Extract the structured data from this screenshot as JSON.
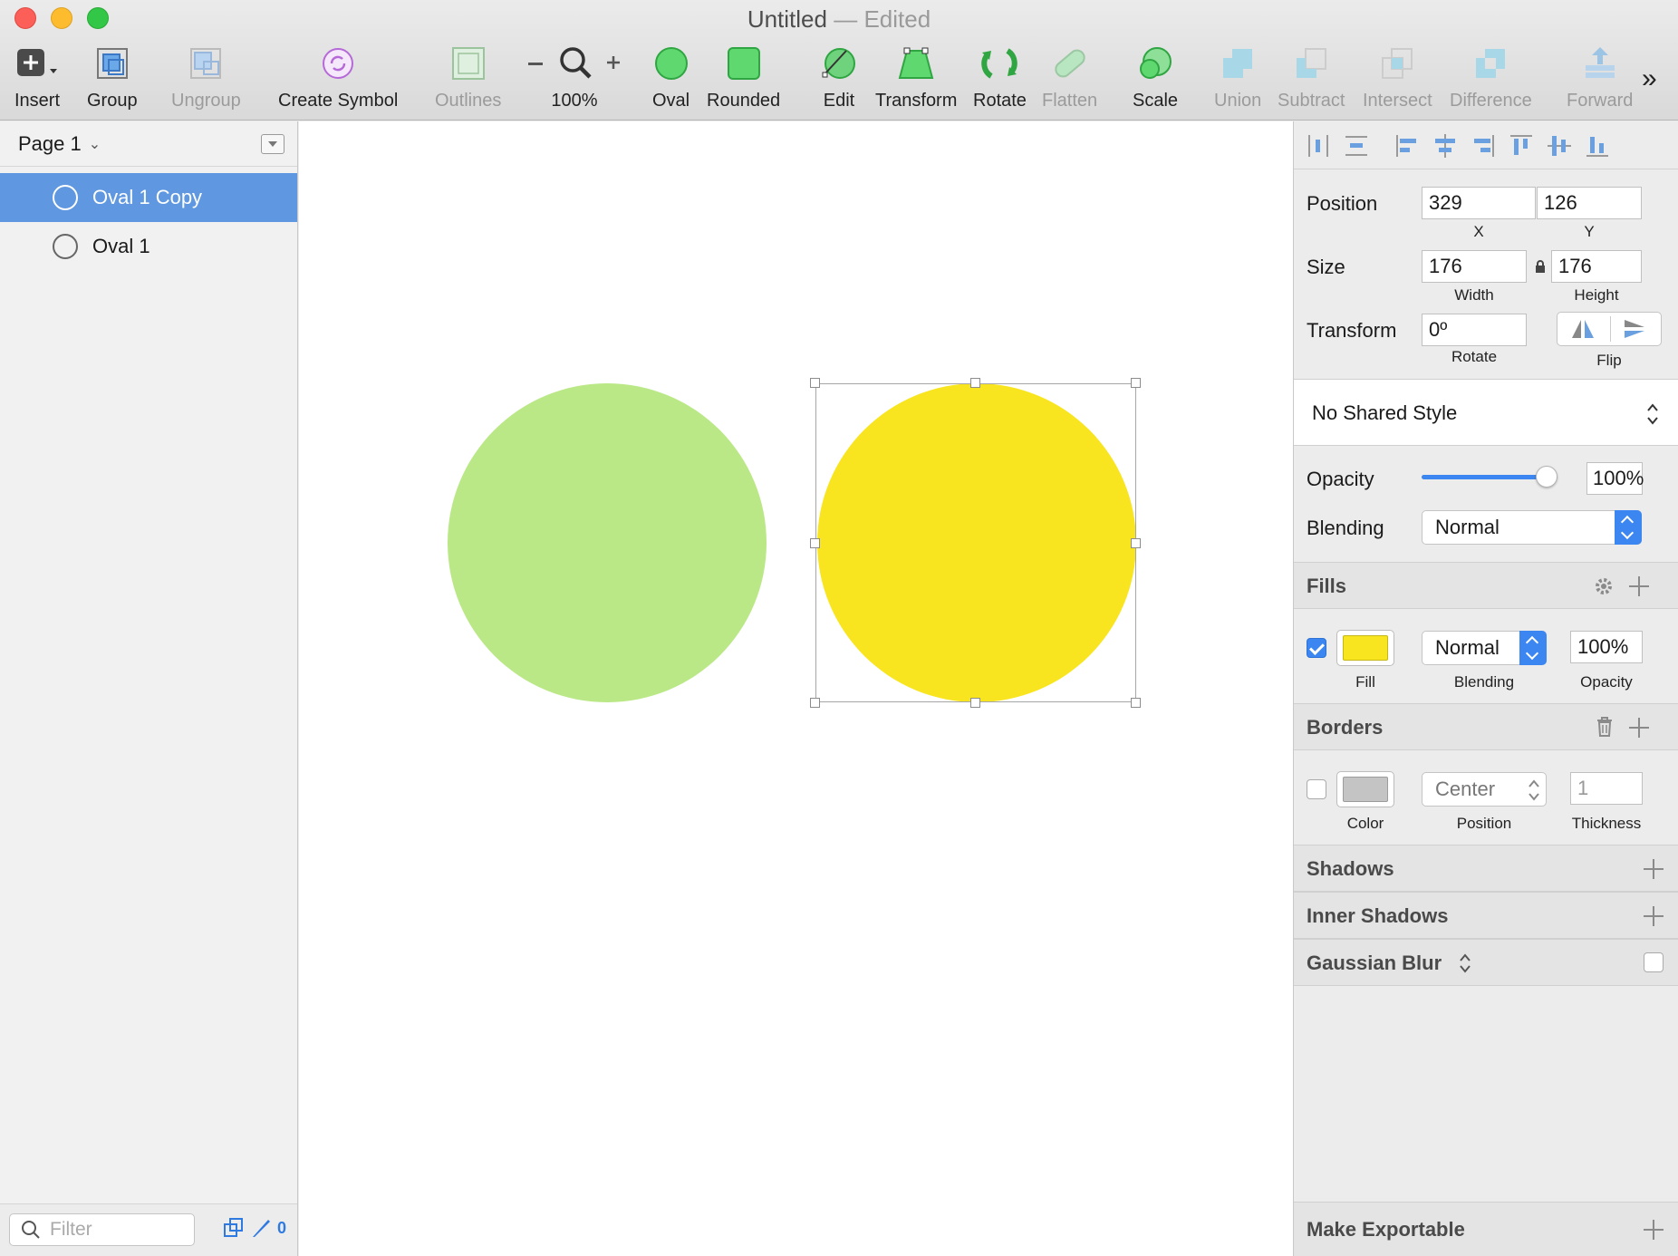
{
  "window": {
    "title": "Untitled",
    "separator": "—",
    "status": "Edited"
  },
  "toolbar": {
    "insert": "Insert",
    "group": "Group",
    "ungroup": "Ungroup",
    "create_symbol": "Create Symbol",
    "outlines": "Outlines",
    "zoom": "100%",
    "oval": "Oval",
    "rounded": "Rounded",
    "edit": "Edit",
    "transform": "Transform",
    "rotate": "Rotate",
    "flatten": "Flatten",
    "scale": "Scale",
    "union": "Union",
    "subtract": "Subtract",
    "intersect": "Intersect",
    "difference": "Difference",
    "forward": "Forward",
    "more": "»"
  },
  "layers": {
    "page": "Page 1",
    "items": [
      {
        "label": "Oval 1 Copy",
        "selected": true
      },
      {
        "label": "Oval 1",
        "selected": false
      }
    ],
    "filter_placeholder": "Filter",
    "edited_count": "0"
  },
  "canvas": {
    "oval_1_color": "#bae886",
    "oval_1_copy_color": "#f8e51f"
  },
  "inspector": {
    "position": {
      "label": "Position",
      "x": "329",
      "y": "126",
      "x_label": "X",
      "y_label": "Y"
    },
    "size": {
      "label": "Size",
      "width": "176",
      "height": "176",
      "width_label": "Width",
      "height_label": "Height"
    },
    "transform": {
      "label": "Transform",
      "rotate": "0º",
      "rotate_label": "Rotate",
      "flip_label": "Flip"
    },
    "shared_style": "No Shared Style",
    "opacity": {
      "label": "Opacity",
      "value": "100%",
      "level": 1.0
    },
    "blending": {
      "label": "Blending",
      "value": "Normal"
    },
    "fills": {
      "title": "Fills",
      "enabled": true,
      "color": "#f8e51f",
      "blending": "Normal",
      "opacity": "100%",
      "fill_label": "Fill",
      "blending_label": "Blending",
      "opacity_label": "Opacity"
    },
    "borders": {
      "title": "Borders",
      "enabled": false,
      "color": "#c4c4c4",
      "position": "Center",
      "thickness": "1",
      "color_label": "Color",
      "position_label": "Position",
      "thickness_label": "Thickness"
    },
    "shadows": "Shadows",
    "inner_shadows": "Inner Shadows",
    "gaussian_blur": "Gaussian Blur",
    "make_exportable": "Make Exportable"
  },
  "colors": {
    "accent": "#3b86f0",
    "selection": "#5f98e0"
  }
}
